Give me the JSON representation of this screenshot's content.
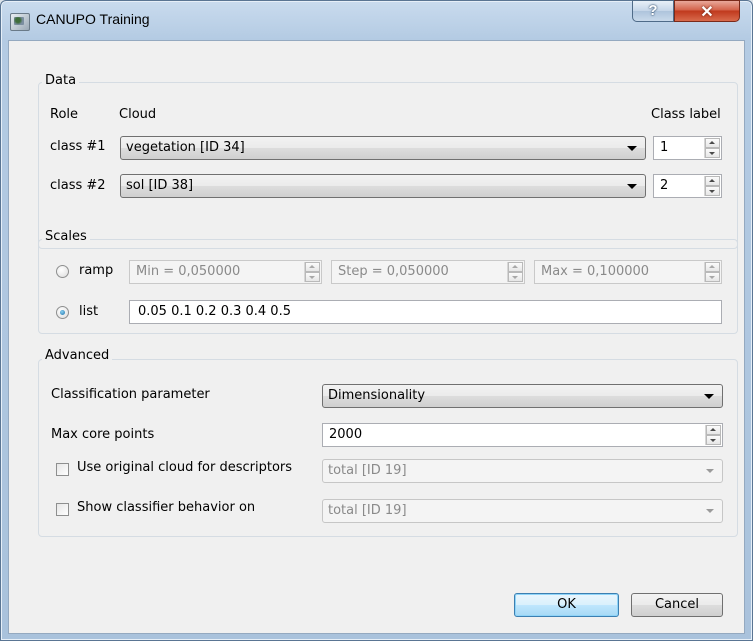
{
  "window": {
    "title": "CANUPO Training",
    "help_glyph": "?",
    "close_glyph": "✕"
  },
  "data_group": {
    "title": "Data",
    "col_role": "Role",
    "col_cloud": "Cloud",
    "col_class_label": "Class label",
    "rows": [
      {
        "role": "class #1",
        "cloud": "vegetation [ID 34]",
        "class_label": "1"
      },
      {
        "role": "class #2",
        "cloud": "sol [ID 38]",
        "class_label": "2"
      }
    ]
  },
  "scales_group": {
    "title": "Scales",
    "ramp_label": "ramp",
    "ramp_selected": false,
    "min_value": "Min = 0,050000",
    "step_value": "Step = 0,050000",
    "max_value": "Max = 0,100000",
    "list_label": "list",
    "list_selected": true,
    "list_value": "0.05 0.1 0.2 0.3 0.4 0.5"
  },
  "advanced_group": {
    "title": "Advanced",
    "classification_parameter_label": "Classification parameter",
    "classification_parameter_value": "Dimensionality",
    "max_core_points_label": "Max core points",
    "max_core_points_value": "2000",
    "use_original_cloud_label": "Use original cloud for descriptors",
    "use_original_cloud_checked": false,
    "use_original_cloud_value": "total [ID 19]",
    "show_classifier_label": "Show classifier behavior on",
    "show_classifier_checked": false,
    "show_classifier_value": "total [ID 19]"
  },
  "buttons": {
    "ok": "OK",
    "cancel": "Cancel"
  },
  "colors": {
    "titlebar": "#b4cbe3",
    "close_button": "#c0391d",
    "default_button_border": "#3c7fb1",
    "radio_dot": "#1b6fa8"
  }
}
